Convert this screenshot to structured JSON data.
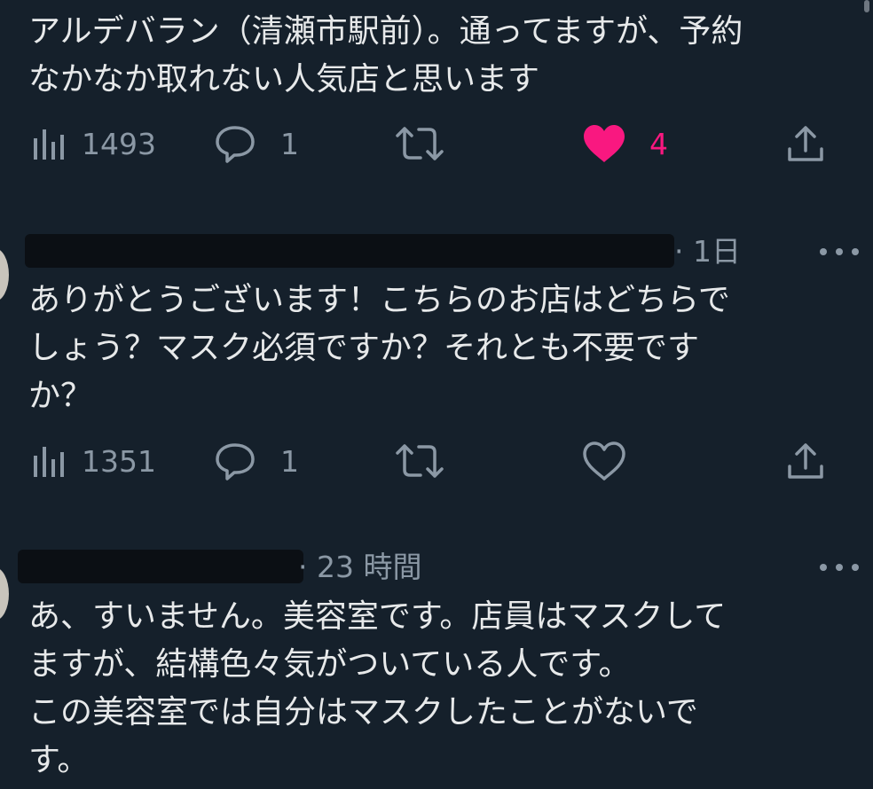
{
  "tweet1": {
    "lines": [
      "アルデバラン（清瀬市駅前）。通ってますが、予約",
      "なかなか取れない人気店と思います"
    ],
    "views": "1493",
    "replies": "1",
    "likes": "4",
    "liked": true
  },
  "tweet2": {
    "meta": "· 1日",
    "lines": [
      "ありがとうございます！こちらのお店はどちらで",
      "しょう？マスク必須ですか？それとも不要です",
      "か？"
    ],
    "views": "1351",
    "replies": "1"
  },
  "tweet3": {
    "meta": "· 23 時間",
    "lines": [
      "あ、すいません。美容室です。店員はマスクして",
      "ますが、結構色々気がついている人です。",
      "この美容室では自分はマスクしたことがないで",
      "す。"
    ]
  },
  "icons": {
    "views": "bar-chart-icon",
    "reply": "speech-bubble-icon",
    "retweet": "retweet-icon",
    "like": "heart-icon",
    "share": "share-icon",
    "more": "more-dots-icon"
  },
  "colors": {
    "background": "#15202b",
    "text": "#e7e9ea",
    "muted": "#8b98a5",
    "like": "#f91880"
  }
}
